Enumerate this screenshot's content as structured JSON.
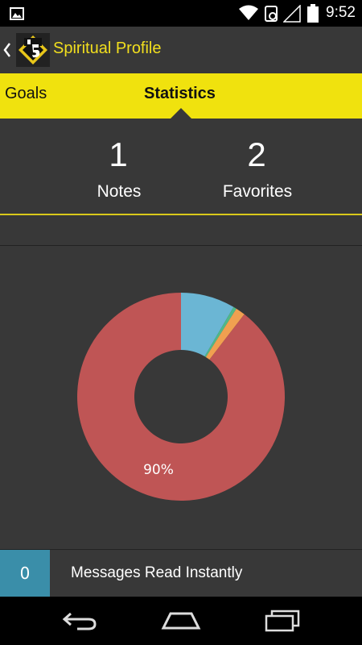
{
  "status_bar": {
    "time": "9:52"
  },
  "action_bar": {
    "title": "Spiritual Profile"
  },
  "tabs": [
    {
      "label": "Goals",
      "selected": false
    },
    {
      "label": "Statistics",
      "selected": true
    }
  ],
  "stats": [
    {
      "value": "1",
      "label": "Notes"
    },
    {
      "value": "2",
      "label": "Favorites"
    }
  ],
  "chart_data": {
    "type": "pie",
    "variant": "donut",
    "values": [
      90,
      8.5,
      1.5,
      0.5
    ],
    "colors": [
      "#bf5555",
      "#6bb6d4",
      "#f0a050",
      "#4fb888"
    ],
    "labels": [
      "90%"
    ]
  },
  "messages_row": {
    "count": "0",
    "label": "Messages Read Instantly"
  },
  "colors": {
    "accent": "#f0e20e",
    "title": "#f2df1e",
    "badge": "#3a8ea9"
  }
}
